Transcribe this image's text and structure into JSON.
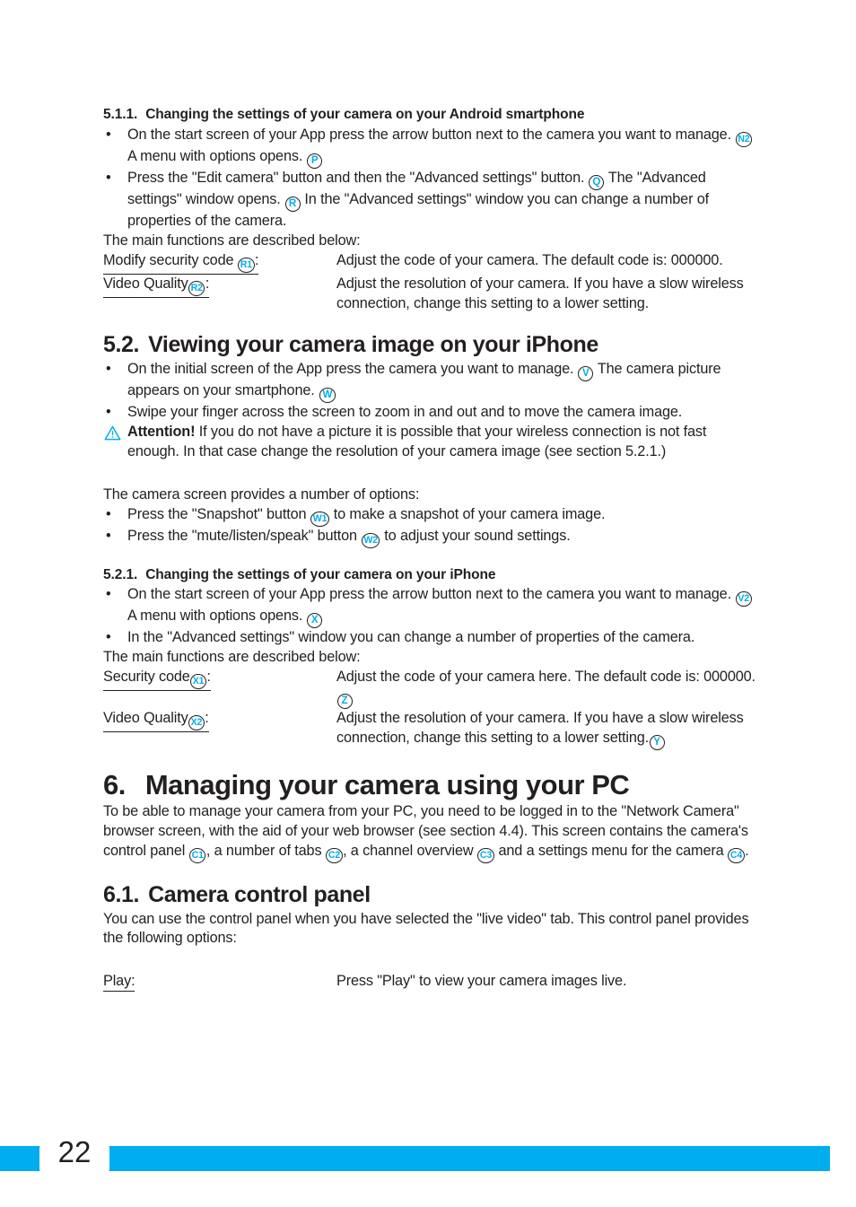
{
  "colors": {
    "accent": "#00AEEF",
    "text": "#231f20"
  },
  "sections": {
    "s511": {
      "number": "5.1.1.",
      "title": "Changing the settings of your camera on your Android smartphone",
      "bullet1_a": "On the start screen of your App press the arrow button next to the camera you want to manage.",
      "bullet1_ref1": "N2",
      "bullet1_b": "A menu with options opens.",
      "bullet1_ref2": "P",
      "bullet2_a": "Press the \"Edit camera\" button and then the \"Advanced settings\" button.",
      "bullet2_ref1": "Q",
      "bullet2_b": "The \"Advanced settings\" window opens.",
      "bullet2_ref2": "R",
      "bullet2_c": "In the \"Advanced settings\" window you can change a number of properties of the camera.",
      "intro": "The main functions are described below:",
      "def1_term": "Modify security code",
      "def1_ref": "R1",
      "def1_desc": "Adjust the code of your camera. The default code is: 000000.",
      "def2_term": "Video Quality",
      "def2_ref": "R2",
      "def2_desc": "Adjust the resolution of your camera. If you have a slow wireless connection, change this setting to a lower setting."
    },
    "s52": {
      "number": "5.2.",
      "title": "Viewing your camera image on your iPhone",
      "bullet1_a": "On the initial screen of the App press the camera you want to manage.",
      "bullet1_ref1": "V",
      "bullet1_b": "The camera picture appears on your smartphone.",
      "bullet1_ref2": "W",
      "bullet2": "Swipe your finger across the screen to zoom in and out and to move the camera image.",
      "attention_label": "Attention!",
      "attention_text": "If you do not have a picture it is possible that your wireless connection is not fast enough. In that case change the resolution of your camera image (see section 5.2.1.)",
      "options_intro": "The camera screen provides a number of options:",
      "opt1_a": "Press the \"Snapshot\" button",
      "opt1_ref": "W1",
      "opt1_b": "to make a snapshot of your camera image.",
      "opt2_a": "Press the \"mute/listen/speak\" button",
      "opt2_ref": "W2",
      "opt2_b": "to adjust your sound settings."
    },
    "s521": {
      "number": "5.2.1.",
      "title": "Changing the settings of your camera on your iPhone",
      "bullet1_a": "On the start screen of your App press the arrow button next to the camera you want to manage.",
      "bullet1_ref1": "V2",
      "bullet1_b": "A menu with options opens.",
      "bullet1_ref2": "X",
      "bullet2": "In the \"Advanced settings\" window you can change a number of properties of the camera.",
      "intro": "The main functions are described below:",
      "def1_term": "Security code",
      "def1_ref": "X1",
      "def1_desc_a": "Adjust the code of your camera here. The default code is: 000000.",
      "def1_ref_end": "Z",
      "def2_term": "Video Quality",
      "def2_ref": "X2",
      "def2_desc_a": "Adjust the resolution of your camera. If you have a slow wireless connection, change this setting to a lower setting.",
      "def2_ref_end": "Y"
    },
    "s6": {
      "number": "6.",
      "title": "Managing your camera using your PC",
      "para_a": "To be able to manage your camera from your PC, you need to be logged in to the \"Network Camera\" browser screen, with the aid of your web browser (see section 4.4). This screen contains the camera's control panel",
      "ref1": "C1",
      "para_b": ", a number of tabs",
      "ref2": "C2",
      "para_c": ", a channel overview",
      "ref3": "C3",
      "para_d": "and a settings menu for the camera",
      "ref4": "C4",
      "para_e": "."
    },
    "s61": {
      "number": "6.1.",
      "title": "Camera control panel",
      "para": "You can use the control panel when you have selected the \"live video\" tab. This control panel provides the following options:",
      "def1_term": "Play:",
      "def1_desc": "Press \"Play\" to view your camera images live."
    }
  },
  "footer": {
    "page_number": "22"
  },
  "icons": {
    "bullet": "•",
    "warning": "warning-triangle-icon"
  }
}
